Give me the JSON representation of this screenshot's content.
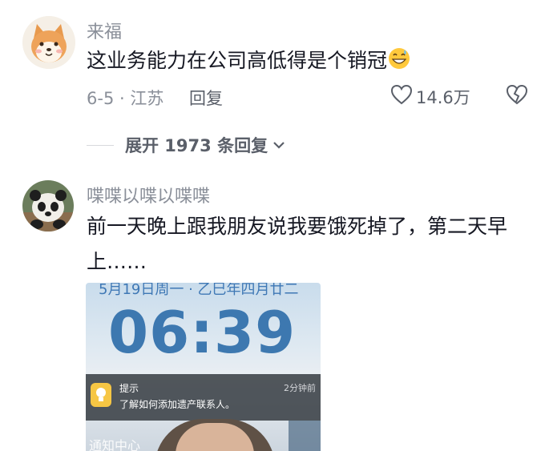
{
  "comment1": {
    "username": "来福",
    "avatar": "shiba-dog-icon",
    "text": "这业务能力在公司高低得是个销冠",
    "emoji": "grinning-sweat-emoji",
    "date_location": "6-5 · 江苏",
    "reply_label": "回复",
    "like_count": "14.6万",
    "like_icon": "heart-outline-icon",
    "dislike_icon": "broken-heart-icon"
  },
  "expand": {
    "label": "展开 1973 条回复",
    "icon": "chevron-down-icon"
  },
  "comment2": {
    "username": "喋喋以喋以喋喋",
    "avatar": "panda-icon",
    "text_line1": "前一天晚上跟我朋友说我要饿死掉了，第二天早",
    "text_line2": "上……",
    "image": {
      "date": "5月19日周一 · 乙巳年四月廿二",
      "time": "06:39",
      "notif_title": "提示",
      "notif_body": "了解如何添加遗产联系人。",
      "notif_time": "2分钟前",
      "notif_center": "通知中心"
    }
  },
  "colors": {
    "text": "#161823",
    "muted": "#8a8f99",
    "clock": "#3d78b0"
  }
}
